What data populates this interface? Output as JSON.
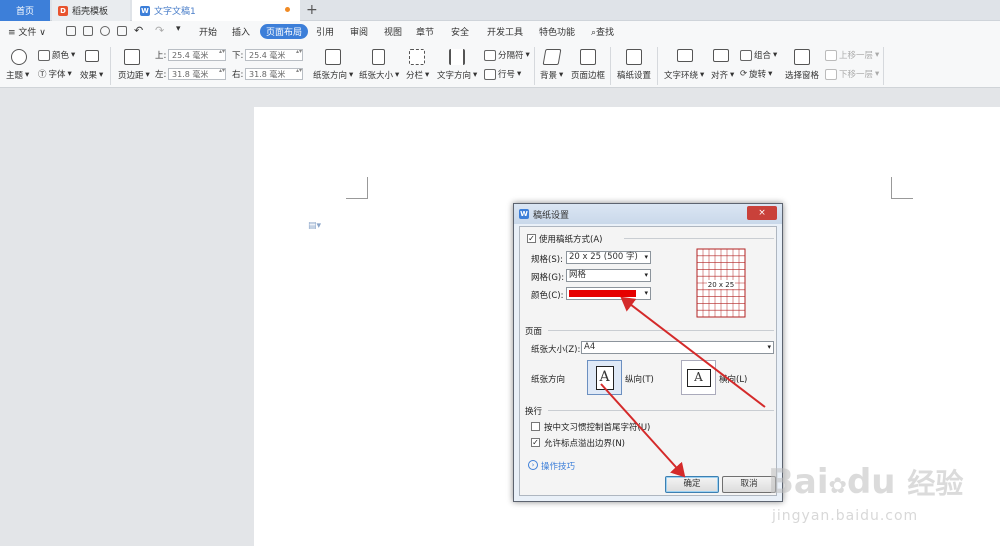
{
  "tabs": [
    {
      "label": "首页"
    },
    {
      "label": "稻壳模板"
    },
    {
      "label": "文字文稿1"
    }
  ],
  "menu": {
    "file": "文件",
    "items": [
      "开始",
      "插入",
      "页面布局",
      "引用",
      "审阅",
      "视图",
      "章节",
      "安全",
      "开发工具",
      "特色功能"
    ],
    "active_index": 2,
    "search": "查找"
  },
  "ribbon": {
    "theme": "主题",
    "color": "颜色",
    "font": "字体",
    "effect": "效果",
    "margins": "页边距",
    "top_label": "上:",
    "top_value": "25.4 毫米",
    "bottom_label": "下:",
    "bottom_value": "25.4 毫米",
    "left_label": "左:",
    "left_value": "31.8 毫米",
    "right_label": "右:",
    "right_value": "31.8 毫米",
    "orientation": "纸张方向",
    "size": "纸张大小",
    "columns": "分栏",
    "text_direction": "文字方向",
    "breaks": "分隔符",
    "line_numbers": "行号",
    "background": "背景",
    "page_border": "页面边框",
    "grid_paper": "稿纸设置",
    "text_wrap": "文字环绕",
    "align": "对齐",
    "group": "组合",
    "rotate": "旋转",
    "selection_pane": "选择窗格",
    "bring_forward": "上移一层",
    "send_backward": "下移一层"
  },
  "dialog": {
    "title": "稿纸设置",
    "close": "×",
    "use_grid_paper": "使用稿纸方式(A)",
    "spec_label": "规格(S):",
    "spec_value": "20 x 25 (500 字)",
    "grid_label": "网格(G):",
    "grid_value": "网格",
    "color_label": "颜色(C):",
    "color_value": "#e60000",
    "preview_label": "20 x 25",
    "page_section": "页面",
    "paper_size_label": "纸张大小(Z):",
    "paper_size_value": "A4",
    "orientation_label": "纸张方向",
    "portrait": "纵向(T)",
    "landscape": "横向(L)",
    "wrap_section": "换行",
    "opt_chinese_rules": "按中文习惯控制首尾字符(U)",
    "opt_punct_overflow": "允许标点溢出边界(N)",
    "tips": "操作技巧",
    "ok": "确定",
    "cancel": "取消"
  },
  "watermark": {
    "brand": "Bai",
    "brand2": "du",
    "cn": "经验",
    "url": "jingyan.baidu.com"
  },
  "colors": {
    "accent": "#3d7fd9",
    "arrow": "#d42a2a",
    "grid": "#b22222"
  }
}
